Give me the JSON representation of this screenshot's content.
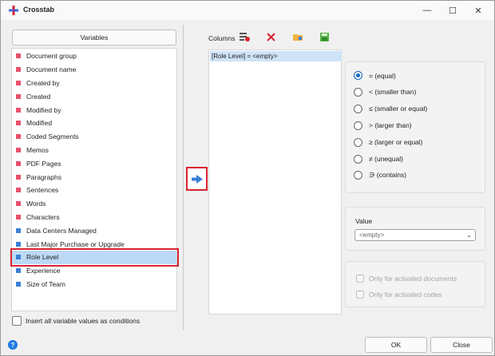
{
  "window": {
    "title": "Crosstab",
    "minimize_glyph": "—",
    "maximize_glyph": "☐",
    "close_glyph": "✕"
  },
  "variables": {
    "button_label": "Variables",
    "items": [
      {
        "label": "Document group",
        "color": "#e8506a"
      },
      {
        "label": "Document name",
        "color": "#e8506a"
      },
      {
        "label": "Created by",
        "color": "#e8506a"
      },
      {
        "label": "Created",
        "color": "#e8506a"
      },
      {
        "label": "Modified by",
        "color": "#e8506a"
      },
      {
        "label": "Modified",
        "color": "#e8506a"
      },
      {
        "label": "Coded Segments",
        "color": "#e8506a"
      },
      {
        "label": "Memos",
        "color": "#e8506a"
      },
      {
        "label": "PDF Pages",
        "color": "#e8506a"
      },
      {
        "label": "Paragraphs",
        "color": "#e8506a"
      },
      {
        "label": "Sentences",
        "color": "#e8506a"
      },
      {
        "label": "Words",
        "color": "#e8506a"
      },
      {
        "label": "Characters",
        "color": "#e8506a"
      },
      {
        "label": "Data Centers Managed",
        "color": "#3a7fd6"
      },
      {
        "label": "Last Major Purchase or Upgrade",
        "color": "#3a7fd6"
      },
      {
        "label": "Role Level",
        "color": "#3a7fd6",
        "selected": true
      },
      {
        "label": "Experience",
        "color": "#3a7fd6"
      },
      {
        "label": "Size of Team",
        "color": "#3a7fd6"
      }
    ],
    "insert_all_label": "Insert all variable values as conditions"
  },
  "columns": {
    "label": "Columns",
    "tools": [
      "add-columns-icon",
      "delete-icon",
      "folder-open-icon",
      "save-icon"
    ],
    "conditions": [
      "[Role Level] = <empty>"
    ]
  },
  "operators": {
    "options": [
      {
        "label": "= (equal)",
        "selected": true
      },
      {
        "label": "< (smaller than)"
      },
      {
        "label": "≤ (smaller or equal)"
      },
      {
        "label": "> (larger than)"
      },
      {
        "label": "≥ (larger or equal)"
      },
      {
        "label": "≠ (unequal)"
      },
      {
        "label": "∋ (contains)"
      }
    ]
  },
  "value": {
    "label": "Value",
    "selected": "<empty>"
  },
  "options": {
    "activated_documents": "Only for activated documents",
    "activated_codes": "Only for activated codes"
  },
  "footer": {
    "help": "?",
    "ok": "OK",
    "close": "Close"
  }
}
